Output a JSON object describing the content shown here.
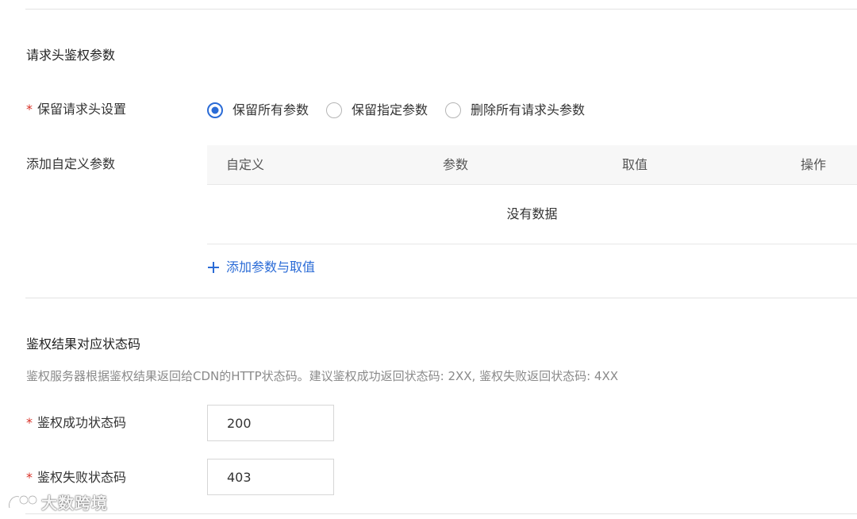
{
  "header_section": {
    "title": "请求头鉴权参数"
  },
  "keep_header": {
    "required_mark": "*",
    "label": "保留请求头设置",
    "options": [
      {
        "label": "保留所有参数",
        "checked": true
      },
      {
        "label": "保留指定参数",
        "checked": false
      },
      {
        "label": "删除所有请求头参数",
        "checked": false
      }
    ]
  },
  "custom_params": {
    "label": "添加自定义参数",
    "columns": [
      "自定义",
      "参数",
      "取值",
      "操作"
    ],
    "empty_text": "没有数据",
    "add_link": "添加参数与取值"
  },
  "status_section": {
    "title": "鉴权结果对应状态码",
    "description": "鉴权服务器根据鉴权结果返回给CDN的HTTP状态码。建议鉴权成功返回状态码: 2XX, 鉴权失败返回状态码: 4XX"
  },
  "success_code": {
    "required_mark": "*",
    "label": "鉴权成功状态码",
    "value": "200"
  },
  "fail_code": {
    "required_mark": "*",
    "label": "鉴权失败状态码",
    "value": "403"
  },
  "watermark": {
    "text": "大数跨境"
  },
  "colors": {
    "accent": "#2a6bd6",
    "required": "#d93026",
    "divider": "#e3e3e3",
    "table_header_bg": "#f7f7f7",
    "muted_text": "#8a8a8a"
  },
  "icons": {
    "add": "plus-icon",
    "watermark_logo": "watermark-logo-icon"
  }
}
